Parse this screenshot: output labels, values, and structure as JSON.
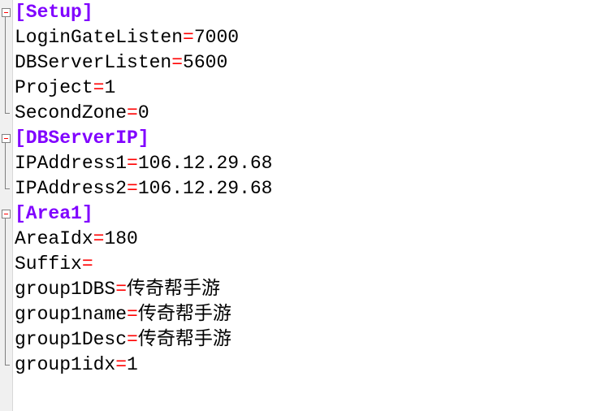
{
  "sections": [
    {
      "header": "[Setup]",
      "entries": [
        {
          "key": "LoginGateListen",
          "value": "7000"
        },
        {
          "key": "DBServerListen",
          "value": "5600"
        },
        {
          "key": "Project",
          "value": "1"
        },
        {
          "key": "SecondZone",
          "value": "0"
        }
      ]
    },
    {
      "header": "[DBServerIP]",
      "entries": [
        {
          "key": "IPAddress1",
          "value": "106.12.29.68"
        },
        {
          "key": "IPAddress2",
          "value": "106.12.29.68"
        }
      ]
    },
    {
      "header": "[Area1]",
      "entries": [
        {
          "key": "AreaIdx",
          "value": "180"
        },
        {
          "key": "Suffix",
          "value": ""
        },
        {
          "key": "group1DBS",
          "value": "传奇帮手游"
        },
        {
          "key": "group1name",
          "value": "传奇帮手游"
        },
        {
          "key": "group1Desc",
          "value": "传奇帮手游"
        },
        {
          "key": "group1idx",
          "value": "1"
        }
      ]
    }
  ],
  "eq": "="
}
